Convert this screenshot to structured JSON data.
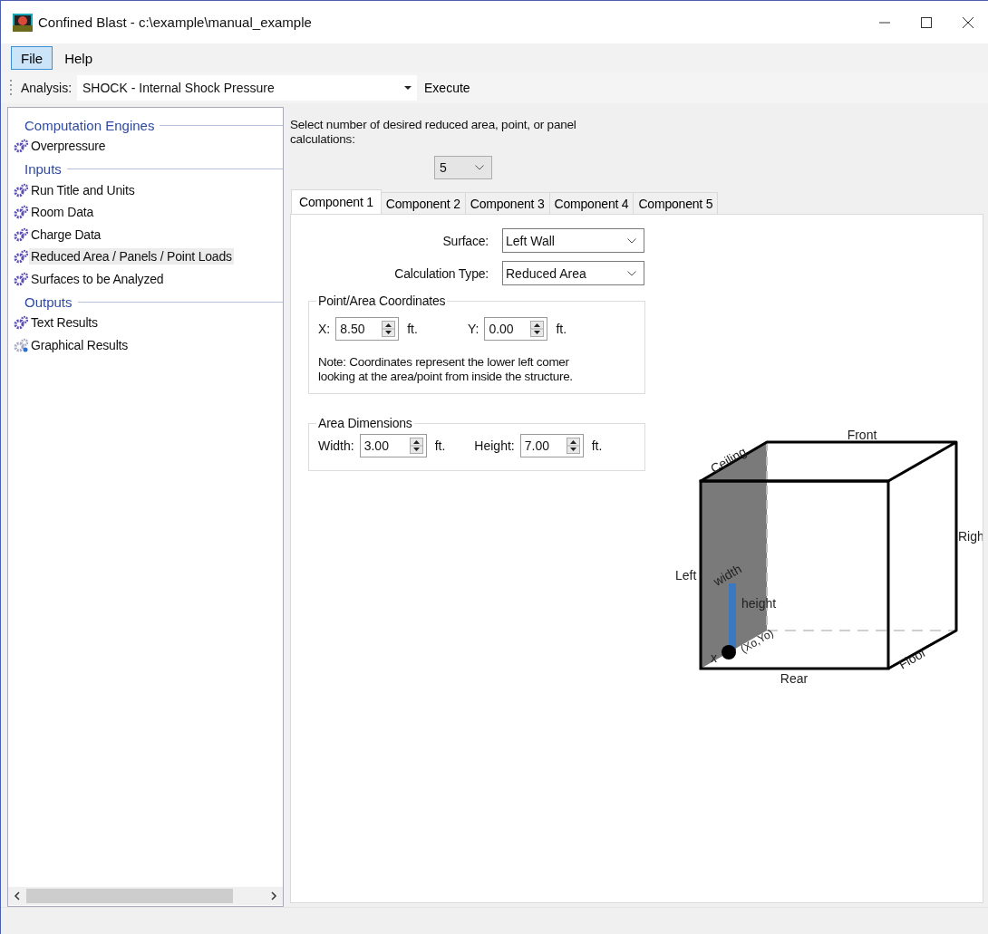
{
  "window": {
    "title": "Confined Blast - c:\\example\\manual_example"
  },
  "menu": [
    {
      "label": "File",
      "selected": true
    },
    {
      "label": "Help",
      "selected": false
    }
  ],
  "toolbar": {
    "analysis_label": "Analysis:",
    "analysis_value": "SHOCK - Internal Shock Pressure",
    "execute": "Execute"
  },
  "sidebar": {
    "groups": [
      {
        "title": "Computation Engines",
        "items": [
          {
            "label": "Overpressure",
            "kind": "gears",
            "selected": false
          }
        ]
      },
      {
        "title": "Inputs",
        "items": [
          {
            "label": "Run Title and Units",
            "kind": "gears",
            "selected": false
          },
          {
            "label": "Room Data",
            "kind": "gears",
            "selected": false
          },
          {
            "label": "Charge Data",
            "kind": "gears",
            "selected": false
          },
          {
            "label": "Reduced Area / Panels / Point Loads",
            "kind": "gears",
            "selected": true
          },
          {
            "label": "Surfaces to be Analyzed",
            "kind": "gears",
            "selected": false
          }
        ]
      },
      {
        "title": "Outputs",
        "items": [
          {
            "label": "Text Results",
            "kind": "gears",
            "selected": false
          },
          {
            "label": "Graphical Results",
            "kind": "gears-help",
            "selected": false
          }
        ]
      }
    ]
  },
  "content": {
    "prompt": "Select number of desired reduced area, point, or panel calculations:",
    "count": "5",
    "tabs": [
      {
        "label": "Component 1",
        "selected": true
      },
      {
        "label": "Component 2",
        "selected": false
      },
      {
        "label": "Component 3",
        "selected": false
      },
      {
        "label": "Component 4",
        "selected": false
      },
      {
        "label": "Component 5",
        "selected": false
      }
    ],
    "surface": {
      "label": "Surface:",
      "value": "Left Wall"
    },
    "calc_type": {
      "label": "Calculation Type:",
      "value": "Reduced Area"
    },
    "coordinates": {
      "title": "Point/Area Coordinates",
      "fields": [
        {
          "label": "X:",
          "value": "8.50",
          "unit": "ft."
        },
        {
          "label": "Y:",
          "value": "0.00",
          "unit": "ft."
        }
      ],
      "note": "Note: Coordinates represent the lower left comer looking at the area/point from inside the structure."
    },
    "dimensions": {
      "title": "Area Dimensions",
      "fields": [
        {
          "label": "Width:",
          "value": "3.00",
          "unit": "ft."
        },
        {
          "label": "Height:",
          "value": "7.00",
          "unit": "ft."
        }
      ]
    },
    "diagram": {
      "labels": [
        {
          "kind": "front",
          "text": "Front"
        },
        {
          "kind": "ceiling",
          "text": "Ceiling"
        },
        {
          "kind": "right",
          "text": "Righ"
        },
        {
          "kind": "left",
          "text": "Left"
        },
        {
          "kind": "width",
          "text": "width"
        },
        {
          "kind": "height",
          "text": "height"
        },
        {
          "kind": "origin",
          "text": "(Xo,Yo)"
        },
        {
          "kind": "x",
          "text": "x"
        },
        {
          "kind": "rear",
          "text": "Rear"
        },
        {
          "kind": "floor",
          "text": "Floor"
        }
      ]
    }
  }
}
